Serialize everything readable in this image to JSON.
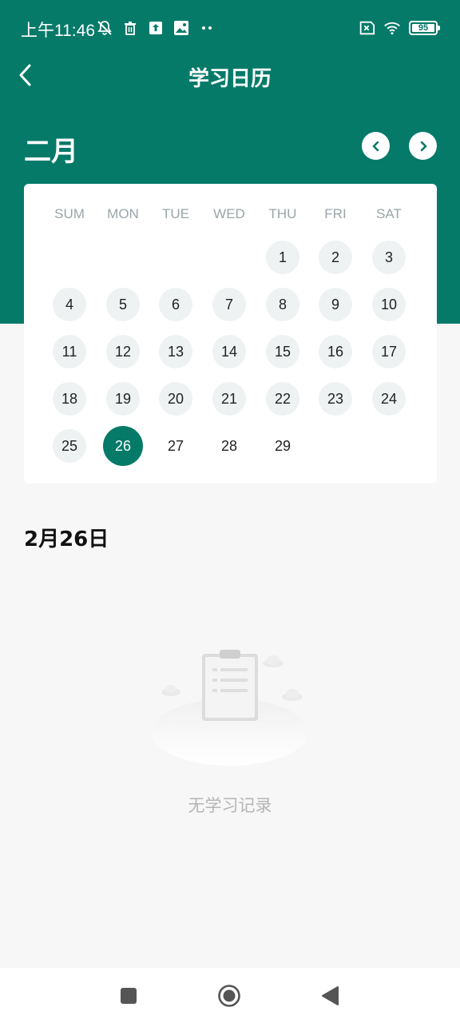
{
  "status_bar": {
    "time": "上午11:46",
    "battery": "95",
    "icons_left": [
      "bell-off-icon",
      "trash-icon",
      "upload-icon",
      "image-icon",
      "more-dots-icon"
    ],
    "icons_right": [
      "sim-off-icon",
      "wifi-icon",
      "battery-icon"
    ]
  },
  "app_bar": {
    "title": "学习日历",
    "back_icon": "chevron-left-icon"
  },
  "calendar": {
    "month": "二月",
    "weekdays": [
      "SUM",
      "MON",
      "TUE",
      "WED",
      "THU",
      "FRI",
      "SAT"
    ],
    "first_weekday_index": 4,
    "days": [
      "1",
      "2",
      "3",
      "4",
      "5",
      "6",
      "7",
      "8",
      "9",
      "10",
      "11",
      "12",
      "13",
      "14",
      "15",
      "16",
      "17",
      "18",
      "19",
      "20",
      "21",
      "22",
      "23",
      "24",
      "25",
      "26",
      "27",
      "28",
      "29"
    ],
    "days_with_background": 25,
    "selected_day": "26"
  },
  "selected_date_label": "2月26日",
  "empty_state": {
    "text": "无学习记录",
    "icon": "clipboard-icon"
  },
  "nav_bar": {
    "icons": [
      "recent-apps-icon",
      "home-icon",
      "back-triangle-icon"
    ]
  },
  "colors": {
    "primary": "#057a69",
    "background": "#f7f7f7",
    "day_circle": "#eef2f2"
  }
}
